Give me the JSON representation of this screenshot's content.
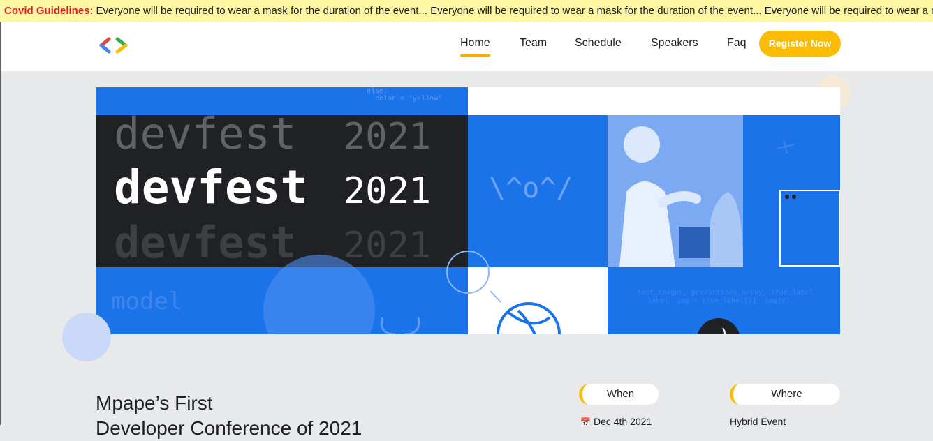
{
  "ticker": {
    "label": "Covid Guidelines:",
    "message": "Everyone will be required to wear a mask for the duration of the event... Everyone will be required to wear a mask for the duration of the event... Everyone will be required to wear a mask for the duration of the event..."
  },
  "nav": {
    "items": [
      {
        "label": "Home",
        "active": true
      },
      {
        "label": "Team"
      },
      {
        "label": "Schedule"
      },
      {
        "label": "Speakers"
      },
      {
        "label": "Faq"
      }
    ],
    "register_label": "Register Now"
  },
  "hero": {
    "word": "devfest",
    "year": "2021",
    "code_line": "else:",
    "code_line2": "color = 'yellow'",
    "emoticon": "\\^o^/",
    "code_snippet": "test_images, predictions_array, true_label",
    "code_snippet2": "label, img = true_label[i], img[i]",
    "faded_word": "model"
  },
  "event": {
    "title_line1": "Mpape’s First",
    "title_line2": "Developer Conference of 2021",
    "when_label": "When",
    "where_label": "Where",
    "when_value": "Dec 4th 2021",
    "where_value": "Hybrid Event"
  }
}
